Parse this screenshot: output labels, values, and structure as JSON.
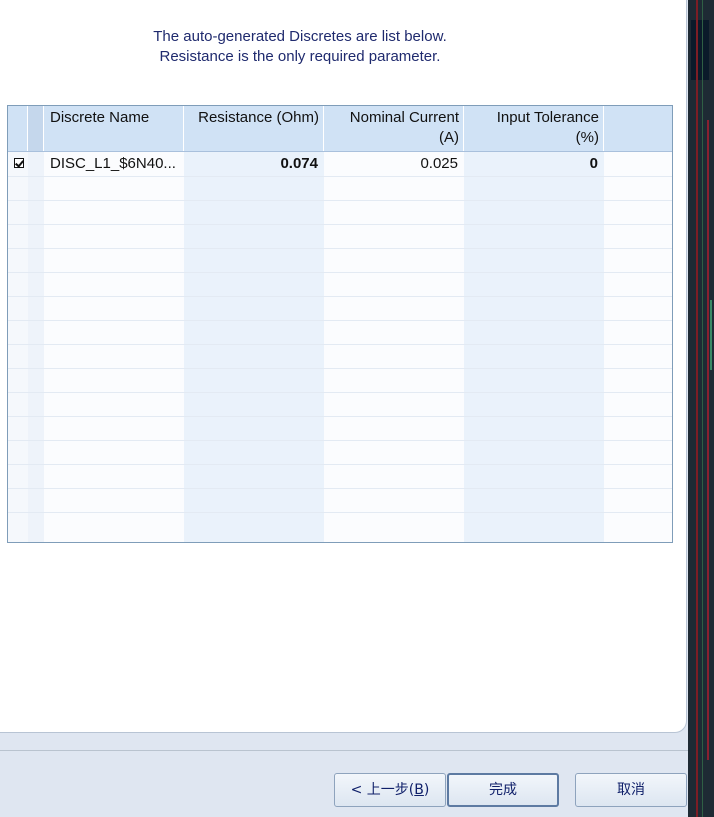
{
  "intro": {
    "line1": "The auto-generated Discretes are list below.",
    "line2": "Resistance is the only required parameter."
  },
  "grid": {
    "columns": {
      "name": "Discrete Name",
      "resistance": "Resistance (Ohm)",
      "current_line1": "Nominal Current",
      "current_line2": "(A)",
      "tolerance_line1": "Input Tolerance",
      "tolerance_line2": "(%)"
    },
    "rows": [
      {
        "checked": true,
        "name": "DISC_L1_$6N40...",
        "resistance": "0.074",
        "current": "0.025",
        "tolerance": "0"
      }
    ]
  },
  "buttons": {
    "back_prefix": "< 上一步(",
    "back_key": "B",
    "back_suffix": ")",
    "finish": "完成",
    "cancel": "取消"
  },
  "colors": {
    "header_bg": "#d0e2f5",
    "intro_text": "#1f2a6e",
    "button_text": "#10206a"
  }
}
